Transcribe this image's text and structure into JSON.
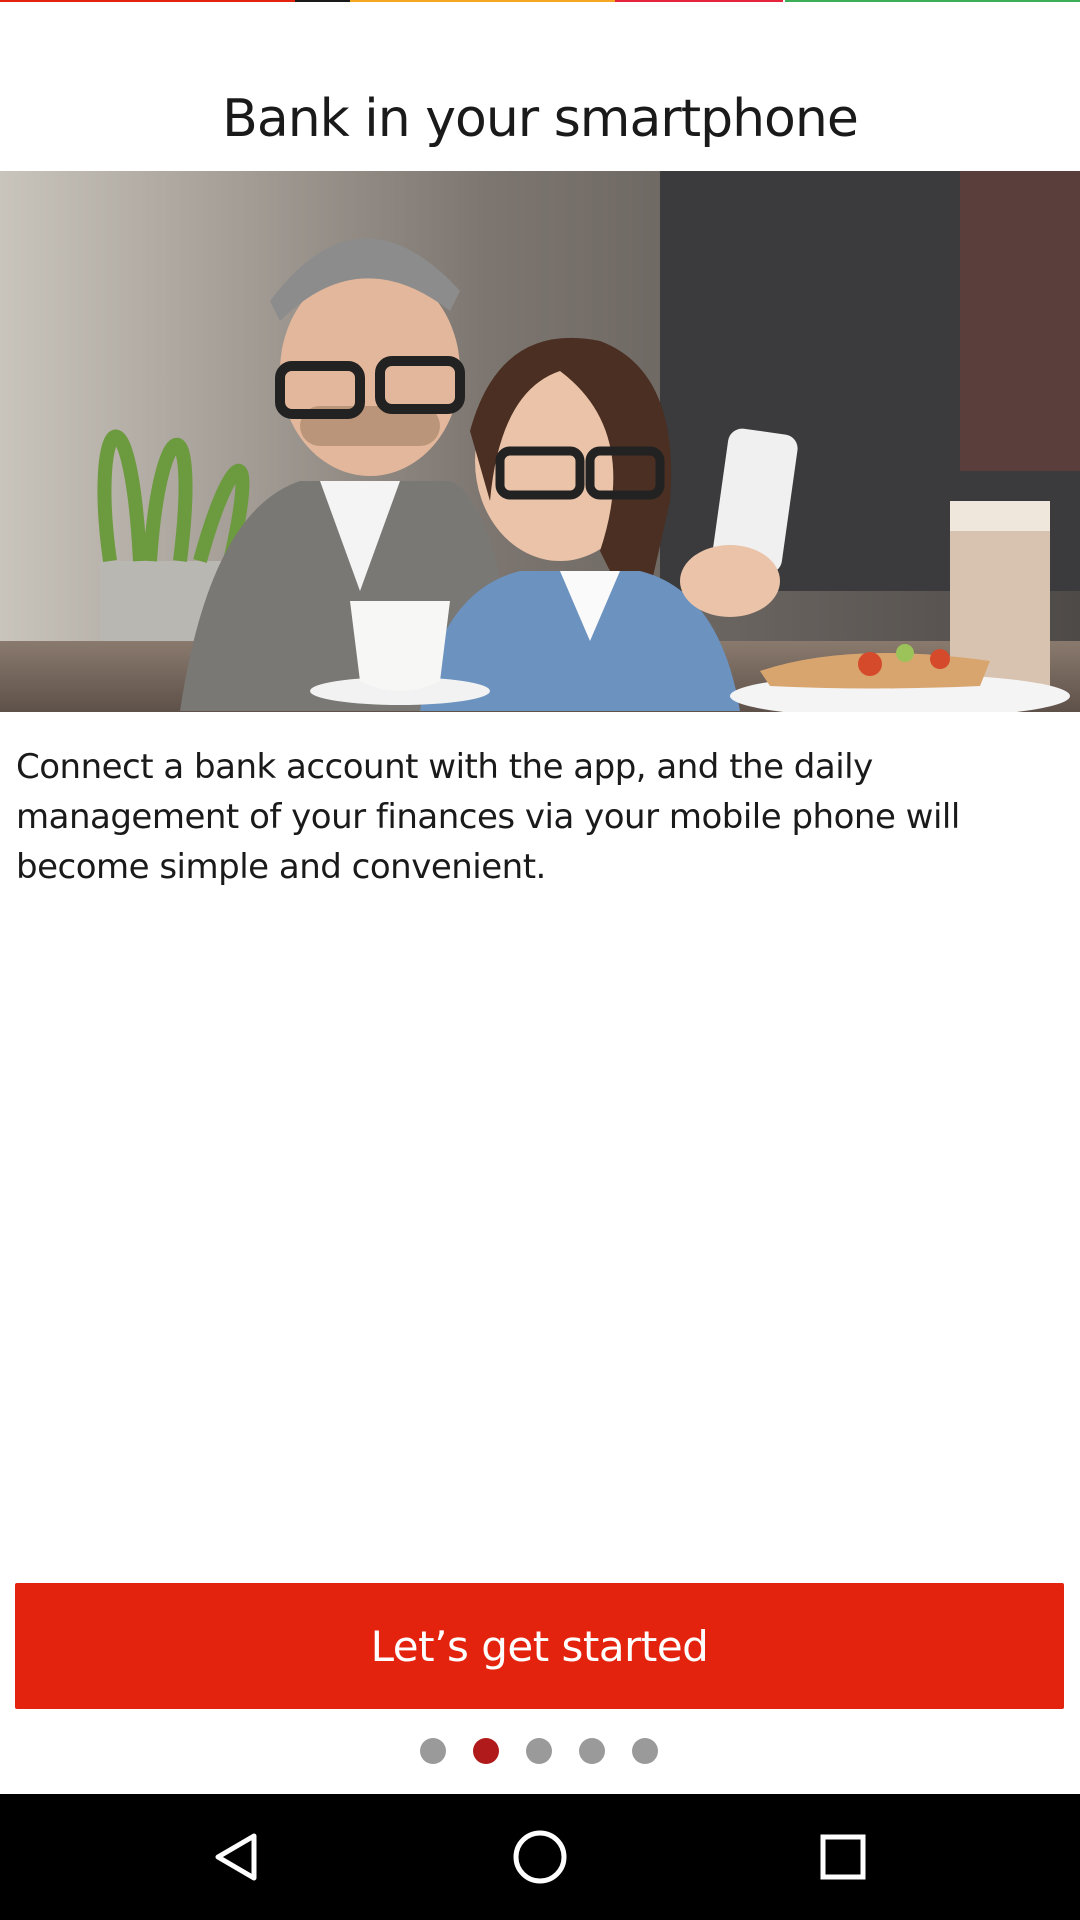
{
  "onboarding": {
    "title": "Bank in your smartphone",
    "description": "Connect a bank account with the app, and the daily management of your finances via your mobile phone will become simple and convenient.",
    "cta_label": "Let’s get started",
    "page_indicator": {
      "total": 5,
      "active_index": 1
    }
  },
  "colors": {
    "accent": "#e4230e",
    "dot_active": "#b01a1a",
    "dot_inactive": "#9a9a9a",
    "top_strip": [
      "#e4230e",
      "#1a1a1a",
      "#f5a623",
      "#e8243c",
      "#3d8fe0",
      "#3cae57"
    ]
  },
  "hero_image": {
    "description_icon": "photo-couple-with-smartphone"
  },
  "navbar": {
    "back_icon": "back-triangle-icon",
    "home_icon": "home-circle-icon",
    "recents_icon": "recents-square-icon"
  }
}
